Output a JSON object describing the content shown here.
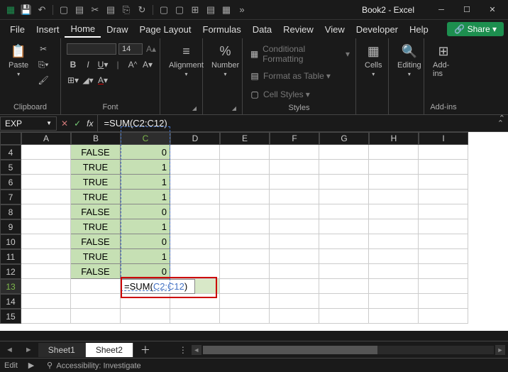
{
  "title": "Book2 - Excel",
  "menus": [
    "File",
    "Insert",
    "Home",
    "Draw",
    "Page Layout",
    "Formulas",
    "Data",
    "Review",
    "View",
    "Developer",
    "Help"
  ],
  "active_menu": "Home",
  "share_label": "Share",
  "ribbon": {
    "clipboard": {
      "label": "Clipboard",
      "paste": "Paste"
    },
    "font": {
      "label": "Font",
      "size": "14"
    },
    "alignment": {
      "label": "Alignment"
    },
    "number": {
      "label": "Number",
      "percent": "%"
    },
    "styles": {
      "label": "Styles",
      "cf": "Conditional Formatting",
      "fat": "Format as Table",
      "cs": "Cell Styles"
    },
    "cells": {
      "label": "Cells",
      "btn": "Cells"
    },
    "editing": {
      "label": "Editing",
      "btn": "Editing"
    },
    "addins": {
      "label": "Add-ins",
      "btn": "Add-ins"
    }
  },
  "namebox": "EXP",
  "formula": {
    "full": "=SUM(C2:C12)",
    "prefix": "=SUM(",
    "ref": "C2:C12",
    "suffix": ")"
  },
  "columns": [
    "A",
    "B",
    "C",
    "D",
    "E",
    "F",
    "G",
    "H",
    "I"
  ],
  "row_start": 4,
  "rows": [
    4,
    5,
    6,
    7,
    8,
    9,
    10,
    11,
    12,
    13,
    14,
    15
  ],
  "sel_col": "C",
  "sel_row": 13,
  "data_rows": [
    {
      "b": "FALSE",
      "c": "0"
    },
    {
      "b": "TRUE",
      "c": "1"
    },
    {
      "b": "TRUE",
      "c": "1"
    },
    {
      "b": "TRUE",
      "c": "1"
    },
    {
      "b": "FALSE",
      "c": "0"
    },
    {
      "b": "TRUE",
      "c": "1"
    },
    {
      "b": "FALSE",
      "c": "0"
    },
    {
      "b": "TRUE",
      "c": "1"
    },
    {
      "b": "FALSE",
      "c": "0"
    }
  ],
  "tabs": [
    "Sheet1",
    "Sheet2"
  ],
  "active_tab": "Sheet2",
  "status": {
    "mode": "Edit",
    "acc": "Accessibility: Investigate"
  }
}
